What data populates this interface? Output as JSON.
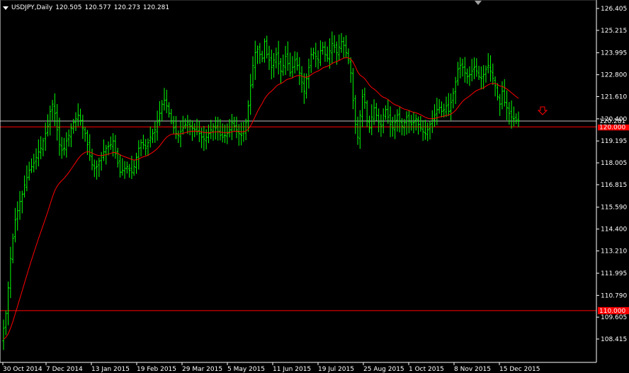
{
  "header": {
    "symbol": "USDJPY,Daily",
    "open": "120.505",
    "high": "120.577",
    "low": "120.273",
    "close": "120.281"
  },
  "colors": {
    "background": "#000000",
    "candle": "#00ff00",
    "moving_average": "#ff0000",
    "axis": "#ffffff",
    "level_line": "#ff0000",
    "bid_line": "#c0c0c0"
  },
  "icons": {
    "shift_marker": "triangle-down-icon",
    "sell_arrow": "arrow-down-icon"
  },
  "chart_data": {
    "type": "bar",
    "y_ticks": [
      "126.405",
      "125.215",
      "123.995",
      "122.800",
      "121.610",
      "120.400",
      "119.195",
      "118.005",
      "116.815",
      "115.590",
      "114.400",
      "113.210",
      "111.995",
      "110.790",
      "109.605",
      "108.415"
    ],
    "x_ticks": [
      "30 Oct 2014",
      "7 Dec 2014",
      "13 Jan 2015",
      "19 Feb 2015",
      "29 Mar 2015",
      "5 May 2015",
      "11 Jun 2015",
      "19 Jul 2015",
      "25 Aug 2015",
      "1 Oct 2015",
      "8 Nov 2015",
      "15 Dec 2015"
    ],
    "ylim": [
      108.4,
      126.4
    ],
    "current_price": "120.281",
    "level_lines": [
      {
        "value": 120.0,
        "label": "120.000"
      },
      {
        "value": 110.0,
        "label": "110.000"
      }
    ],
    "close_values": [
      109.0,
      109.8,
      111.2,
      112.8,
      113.9,
      114.9,
      115.4,
      115.9,
      116.3,
      116.8,
      117.2,
      117.6,
      117.8,
      118.0,
      118.3,
      118.6,
      118.8,
      119.2,
      119.6,
      120.0,
      120.8,
      121.2,
      120.7,
      119.8,
      119.0,
      118.7,
      118.8,
      119.2,
      119.5,
      119.9,
      120.2,
      120.4,
      120.6,
      120.3,
      119.9,
      119.6,
      119.0,
      118.4,
      117.9,
      117.7,
      117.8,
      118.1,
      118.4,
      118.6,
      118.8,
      118.9,
      119.0,
      119.2,
      118.5,
      118.0,
      117.5,
      117.6,
      117.7,
      117.8,
      117.6,
      117.5,
      117.8,
      118.3,
      118.8,
      119.1,
      119.0,
      118.8,
      119.1,
      119.4,
      119.6,
      119.8,
      120.2,
      120.7,
      121.2,
      121.4,
      121.1,
      120.7,
      120.3,
      119.9,
      119.6,
      119.5,
      119.7,
      119.9,
      120.1,
      120.2,
      120.0,
      119.9,
      119.8,
      119.7,
      119.6,
      119.4,
      119.3,
      119.4,
      119.6,
      119.8,
      120.0,
      119.9,
      119.7,
      119.5,
      119.4,
      119.5,
      119.6,
      119.8,
      120.2,
      120.0,
      119.8,
      119.6,
      119.5,
      119.7,
      120.2,
      121.1,
      122.2,
      123.3,
      124.0,
      124.2,
      123.9,
      123.7,
      124.6,
      123.9,
      123.6,
      123.2,
      123.6,
      123.9,
      123.4,
      123.0,
      123.3,
      123.8,
      123.4,
      122.9,
      123.2,
      123.6,
      123.3,
      122.9,
      122.4,
      121.9,
      122.6,
      123.2,
      123.9,
      124.0,
      123.8,
      123.6,
      124.1,
      124.3,
      123.9,
      123.7,
      124.1,
      124.5,
      124.3,
      124.0,
      124.3,
      124.6,
      124.4,
      124.0,
      123.6,
      122.9,
      121.4,
      120.1,
      119.4,
      120.6,
      121.6,
      121.3,
      120.3,
      119.9,
      120.5,
      121.0,
      120.6,
      120.2,
      120.0,
      120.6,
      120.9,
      120.5,
      120.1,
      119.9,
      120.2,
      120.6,
      120.3,
      120.0,
      120.2,
      120.5,
      120.3,
      120.1,
      120.2,
      120.4,
      120.1,
      119.9,
      119.7,
      119.6,
      119.8,
      120.1,
      120.4,
      120.6,
      120.9,
      121.0,
      120.8,
      120.9,
      121.1,
      120.8,
      121.3,
      121.8,
      122.4,
      123.1,
      123.3,
      123.2,
      122.9,
      122.7,
      122.8,
      123.0,
      123.2,
      123.0,
      122.7,
      122.6,
      122.8,
      123.1,
      123.3,
      123.0,
      122.6,
      122.2,
      121.6,
      121.2,
      121.9,
      121.3,
      121.0,
      120.7,
      120.5,
      120.4,
      120.3,
      120.3
    ]
  }
}
